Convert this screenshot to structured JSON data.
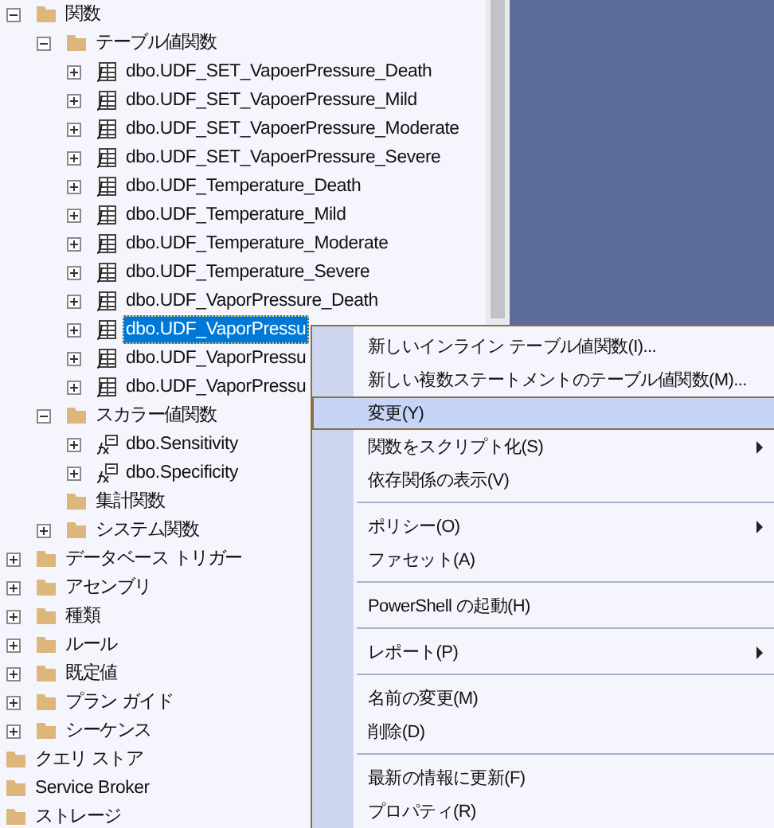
{
  "tree": {
    "items": [
      {
        "children": [
          {
            "label": "関数",
            "kind": "folder",
            "expandable": true,
            "expanded": true,
            "selected": false,
            "children": [
              {
                "label": "テーブル値関数",
                "kind": "folder",
                "expandable": true,
                "expanded": true,
                "selected": false,
                "children": [
                  {
                    "label": "dbo.UDF_SET_VapoerPressure_Death",
                    "kind": "table-function",
                    "expandable": true,
                    "expanded": false,
                    "selected": false
                  },
                  {
                    "label": "dbo.UDF_SET_VapoerPressure_Mild",
                    "kind": "table-function",
                    "expandable": true,
                    "expanded": false,
                    "selected": false
                  },
                  {
                    "label": "dbo.UDF_SET_VapoerPressure_Moderate",
                    "kind": "table-function",
                    "expandable": true,
                    "expanded": false,
                    "selected": false
                  },
                  {
                    "label": "dbo.UDF_SET_VapoerPressure_Severe",
                    "kind": "table-function",
                    "expandable": true,
                    "expanded": false,
                    "selected": false
                  },
                  {
                    "label": "dbo.UDF_Temperature_Death",
                    "kind": "table-function",
                    "expandable": true,
                    "expanded": false,
                    "selected": false
                  },
                  {
                    "label": "dbo.UDF_Temperature_Mild",
                    "kind": "table-function",
                    "expandable": true,
                    "expanded": false,
                    "selected": false
                  },
                  {
                    "label": "dbo.UDF_Temperature_Moderate",
                    "kind": "table-function",
                    "expandable": true,
                    "expanded": false,
                    "selected": false
                  },
                  {
                    "label": "dbo.UDF_Temperature_Severe",
                    "kind": "table-function",
                    "expandable": true,
                    "expanded": false,
                    "selected": false
                  },
                  {
                    "label": "dbo.UDF_VaporPressure_Death",
                    "kind": "table-function",
                    "expandable": true,
                    "expanded": false,
                    "selected": false
                  },
                  {
                    "label": "dbo.UDF_VaporPressu",
                    "kind": "table-function",
                    "expandable": true,
                    "expanded": false,
                    "selected": true
                  },
                  {
                    "label": "dbo.UDF_VaporPressu",
                    "kind": "table-function",
                    "expandable": true,
                    "expanded": false,
                    "selected": false
                  },
                  {
                    "label": "dbo.UDF_VaporPressu",
                    "kind": "table-function",
                    "expandable": true,
                    "expanded": false,
                    "selected": false
                  }
                ]
              },
              {
                "label": "スカラー値関数",
                "kind": "folder",
                "expandable": true,
                "expanded": true,
                "selected": false,
                "children": [
                  {
                    "label": "dbo.Sensitivity",
                    "kind": "scalar-function",
                    "expandable": true,
                    "expanded": false,
                    "selected": false
                  },
                  {
                    "label": "dbo.Specificity",
                    "kind": "scalar-function",
                    "expandable": true,
                    "expanded": false,
                    "selected": false
                  }
                ]
              },
              {
                "label": "集計関数",
                "kind": "folder",
                "expandable": false,
                "selected": false
              },
              {
                "label": "システム関数",
                "kind": "folder",
                "expandable": true,
                "expanded": false,
                "selected": false
              }
            ]
          },
          {
            "label": "データベース トリガー",
            "kind": "folder",
            "expandable": true,
            "expanded": false,
            "selected": false
          },
          {
            "label": "アセンブリ",
            "kind": "folder",
            "expandable": true,
            "expanded": false,
            "selected": false
          },
          {
            "label": "種類",
            "kind": "folder",
            "expandable": true,
            "expanded": false,
            "selected": false
          },
          {
            "label": "ルール",
            "kind": "folder",
            "expandable": true,
            "expanded": false,
            "selected": false
          },
          {
            "label": "既定値",
            "kind": "folder",
            "expandable": true,
            "expanded": false,
            "selected": false
          },
          {
            "label": "プラン ガイド",
            "kind": "folder",
            "expandable": true,
            "expanded": false,
            "selected": false
          },
          {
            "label": "シーケンス",
            "kind": "folder",
            "expandable": true,
            "expanded": false,
            "selected": false
          }
        ]
      },
      {
        "label": "クエリ ストア",
        "kind": "folder",
        "expandable": false,
        "selected": false
      },
      {
        "label": "Service Broker",
        "kind": "folder",
        "expandable": false,
        "selected": false
      },
      {
        "label": "ストレージ",
        "kind": "folder",
        "expandable": false,
        "selected": false
      }
    ]
  },
  "context_menu": {
    "items": [
      {
        "kind": "item",
        "label": "新しいインライン テーブル値関数(I)...",
        "selected": false,
        "submenu": false
      },
      {
        "kind": "item",
        "label": "新しい複数ステートメントのテーブル値関数(M)...",
        "selected": false,
        "submenu": false
      },
      {
        "kind": "item",
        "label": "変更(Y)",
        "selected": true,
        "submenu": false
      },
      {
        "kind": "item",
        "label": "関数をスクリプト化(S)",
        "selected": false,
        "submenu": true
      },
      {
        "kind": "item",
        "label": "依存関係の表示(V)",
        "selected": false,
        "submenu": false
      },
      {
        "kind": "separator"
      },
      {
        "kind": "item",
        "label": "ポリシー(O)",
        "selected": false,
        "submenu": true
      },
      {
        "kind": "item",
        "label": "ファセット(A)",
        "selected": false,
        "submenu": false
      },
      {
        "kind": "separator"
      },
      {
        "kind": "item",
        "label": "PowerShell の起動(H)",
        "selected": false,
        "submenu": false
      },
      {
        "kind": "separator"
      },
      {
        "kind": "item",
        "label": "レポート(P)",
        "selected": false,
        "submenu": true
      },
      {
        "kind": "separator"
      },
      {
        "kind": "item",
        "label": "名前の変更(M)",
        "selected": false,
        "submenu": false
      },
      {
        "kind": "item",
        "label": "削除(D)",
        "selected": false,
        "submenu": false
      },
      {
        "kind": "separator"
      },
      {
        "kind": "item",
        "label": "最新の情報に更新(F)",
        "selected": false,
        "submenu": false
      },
      {
        "kind": "item",
        "label": "プロパティ(R)",
        "selected": false,
        "submenu": false
      }
    ]
  }
}
